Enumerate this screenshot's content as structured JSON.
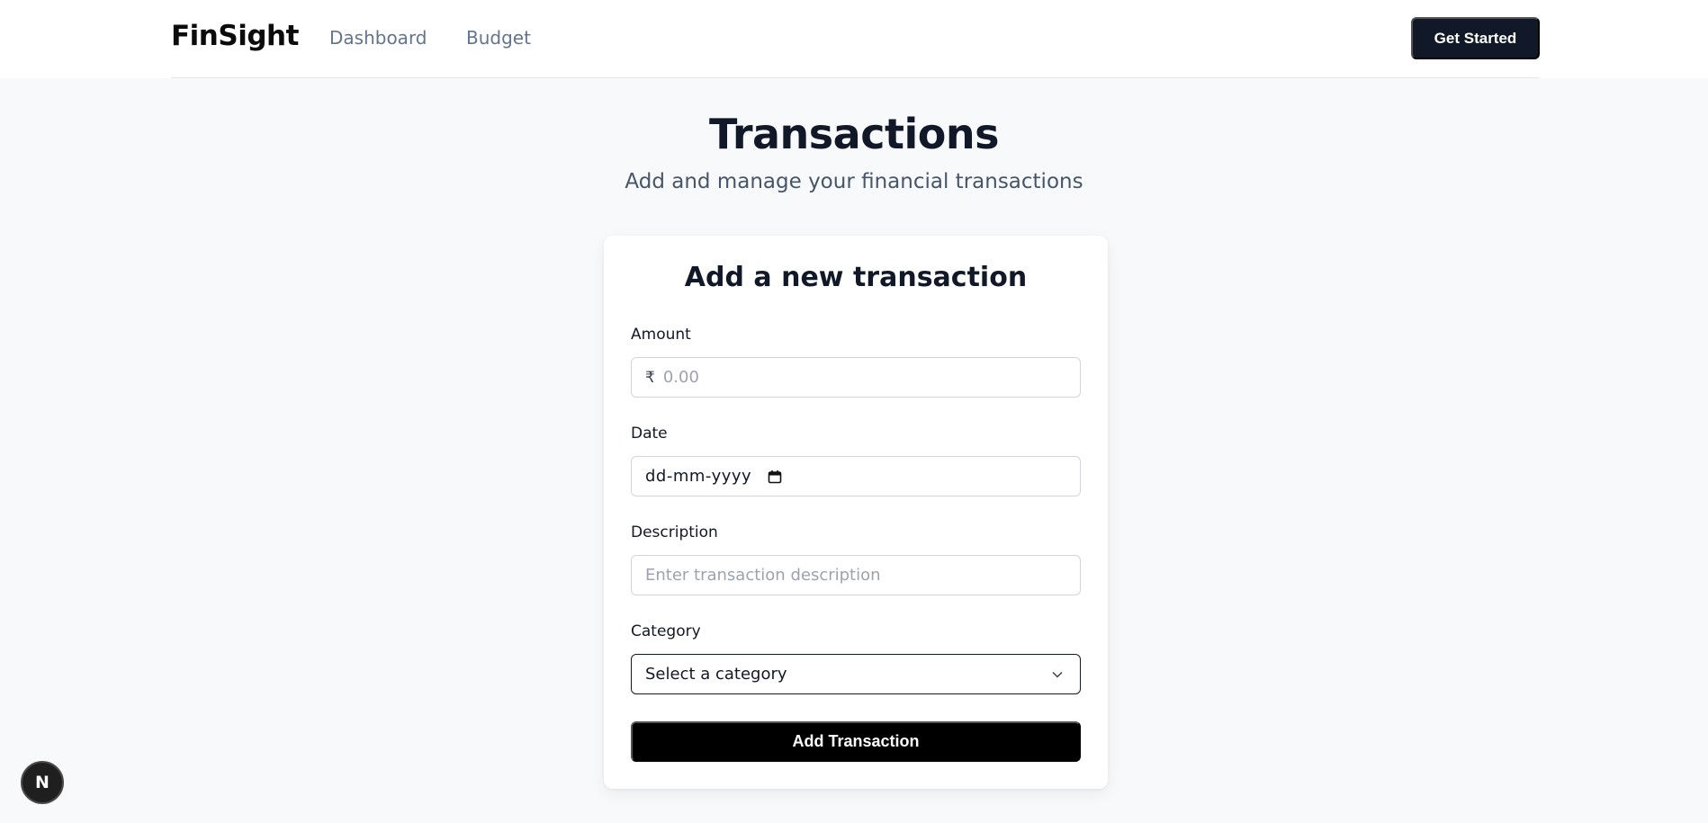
{
  "nav": {
    "brand": "FinSight",
    "links": [
      "Dashboard",
      "Budget"
    ],
    "cta_label": "Get Started"
  },
  "header": {
    "title": "Transactions",
    "subtitle": "Add and manage your financial transactions"
  },
  "form": {
    "title": "Add a new transaction",
    "amount": {
      "label": "Amount",
      "currency_symbol": "₹",
      "placeholder": "0.00"
    },
    "date": {
      "label": "Date",
      "value": "dd-mm-yyyy"
    },
    "description": {
      "label": "Description",
      "placeholder": "Enter transaction description"
    },
    "category": {
      "label": "Category",
      "selected": "Select a category"
    },
    "submit_label": "Add Transaction"
  },
  "dev_badge": {
    "letter": "N"
  },
  "colors": {
    "primary": "#111827",
    "button": "#000000",
    "background": "#f8f9fb",
    "muted": "#64748b"
  }
}
